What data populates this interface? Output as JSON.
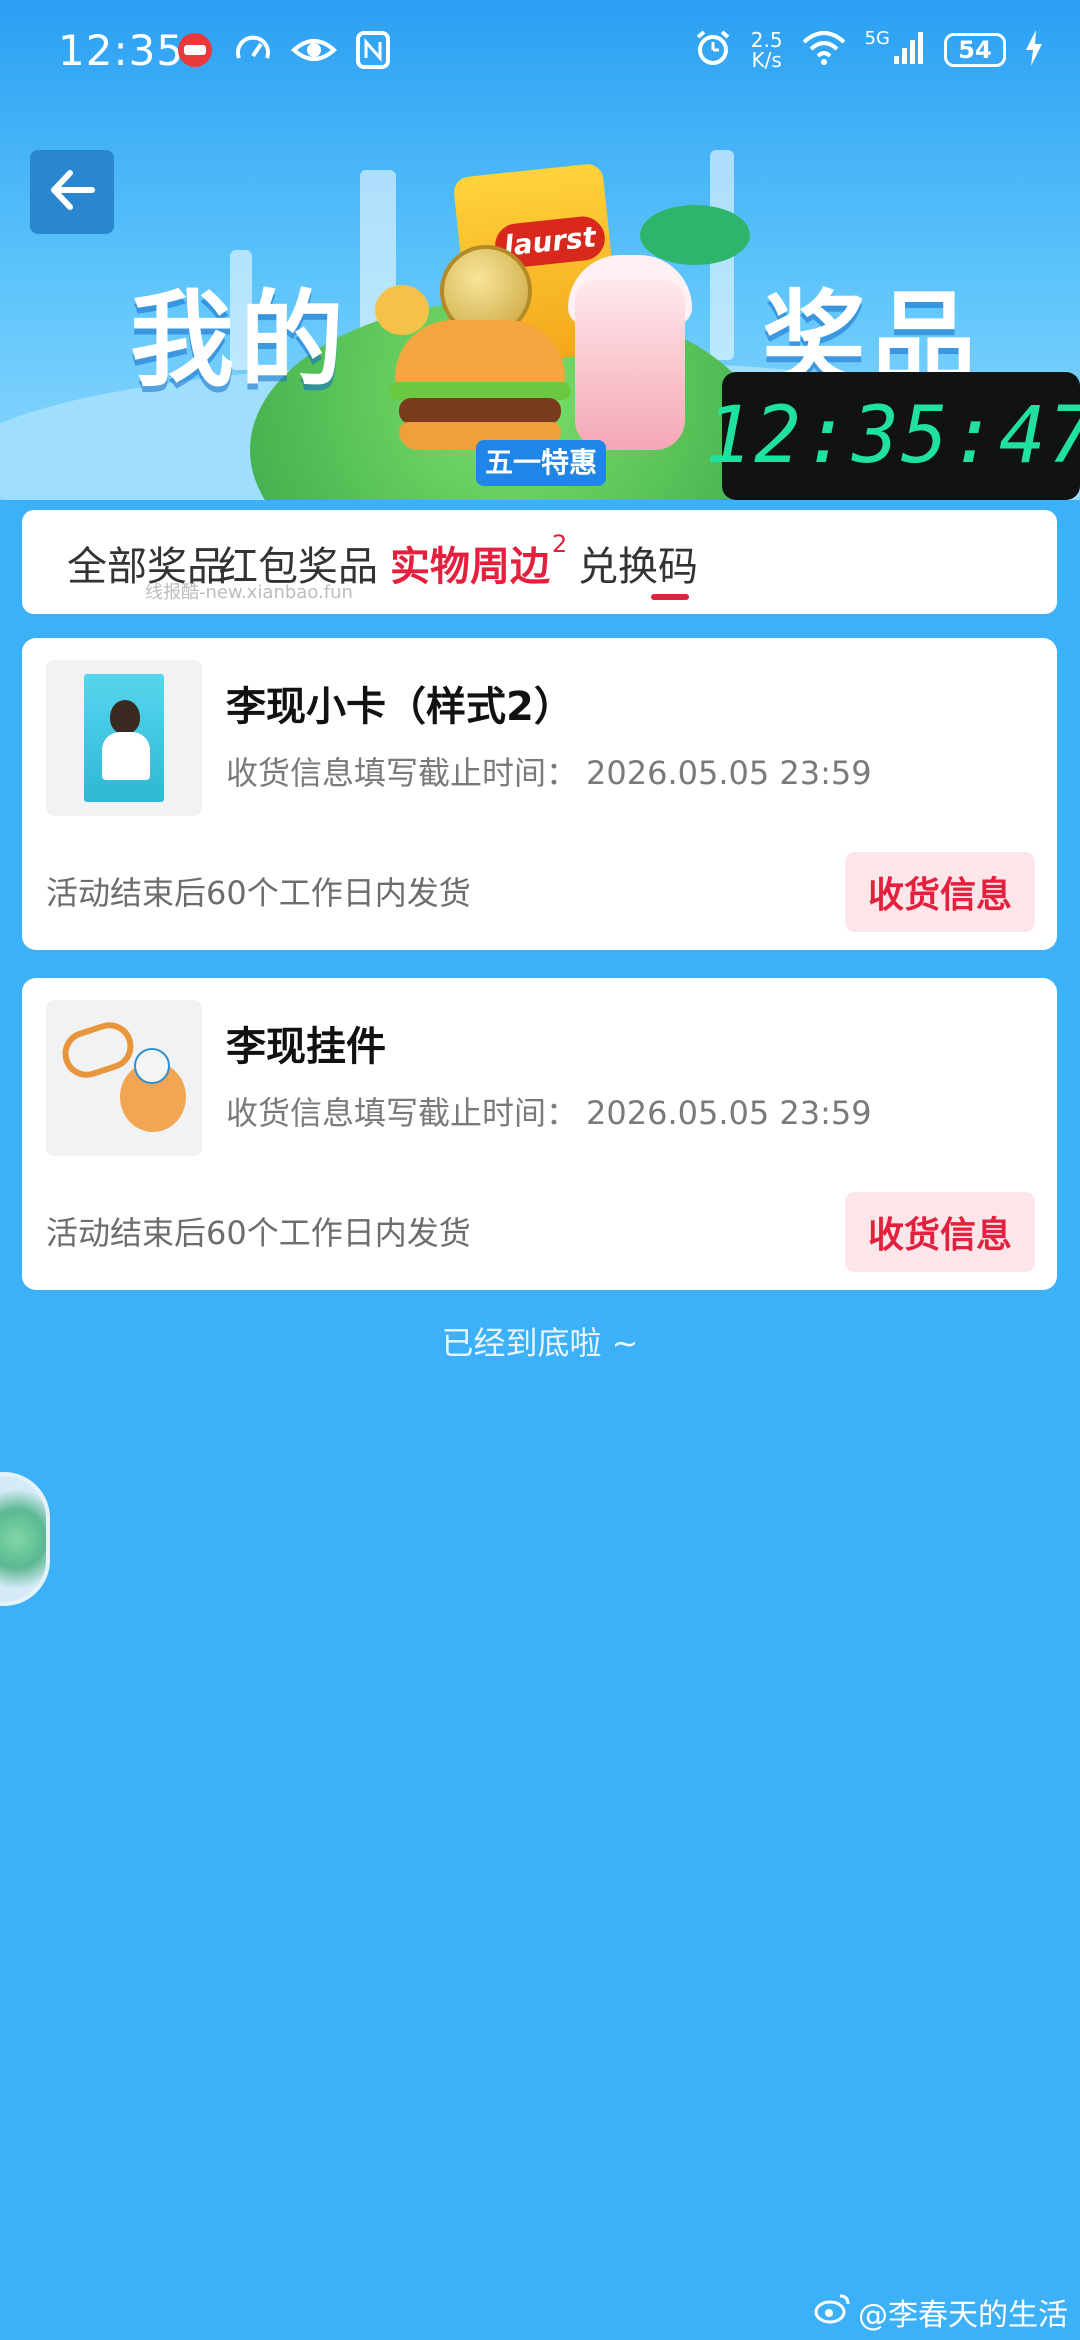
{
  "status_bar": {
    "time": "12:35",
    "net_speed_value": "2.5",
    "net_speed_unit": "K/s",
    "network_label": "5G",
    "battery_level": "54"
  },
  "banner": {
    "title_left": "我的",
    "title_right": "奖品",
    "chips_brand": "laurst",
    "promo_tag": "五一特惠"
  },
  "clock": {
    "time": "12:35:47"
  },
  "tabs": [
    {
      "label": "全部奖品",
      "active": false
    },
    {
      "label": "红包奖品",
      "active": false
    },
    {
      "label": "实物周边",
      "active": true,
      "badge": "2"
    },
    {
      "label": "兑换码",
      "active": false
    }
  ],
  "watermark": "线报酷-new.xianbao.fun",
  "prizes": [
    {
      "title": "李现小卡（样式2）",
      "deadline_label": "收货信息填写截止时间：",
      "deadline_value": "2026.05.05 23:59",
      "note": "活动结束后60个工作日内发货",
      "button": "收货信息"
    },
    {
      "title": "李现挂件",
      "deadline_label": "收货信息填写截止时间：",
      "deadline_value": "2026.05.05 23:59",
      "note": "活动结束后60个工作日内发货",
      "button": "收货信息"
    }
  ],
  "end_text": "已经到底啦 ~",
  "footer_watermark": "@李春天的生活",
  "colors": {
    "page_background": "#3db1f8",
    "accent_red": "#e3203d",
    "button_background": "#fde6ea",
    "clock_digits": "#21e1a0"
  },
  "icons": {
    "back": "arrow-left-icon",
    "alarm": "alarm-clock-icon",
    "wifi": "wifi-icon",
    "signal": "cell-signal-icon",
    "charging": "charging-bolt-icon",
    "weibo": "weibo-icon"
  }
}
